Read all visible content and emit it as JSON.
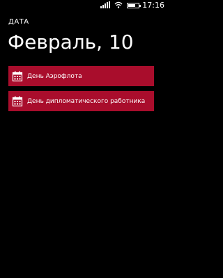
{
  "status": {
    "time": "17:16",
    "battery_level": 0.7
  },
  "header": {
    "section_label": "ДАТА",
    "title": "Февраль, 10"
  },
  "holidays": [
    {
      "label": "День Аэрофлота",
      "icon": "calendar-icon"
    },
    {
      "label": "День дипломатического работника",
      "icon": "calendar-icon"
    }
  ],
  "colors": {
    "background": "#000000",
    "accent": "#a90d2c",
    "text": "#ffffff"
  }
}
